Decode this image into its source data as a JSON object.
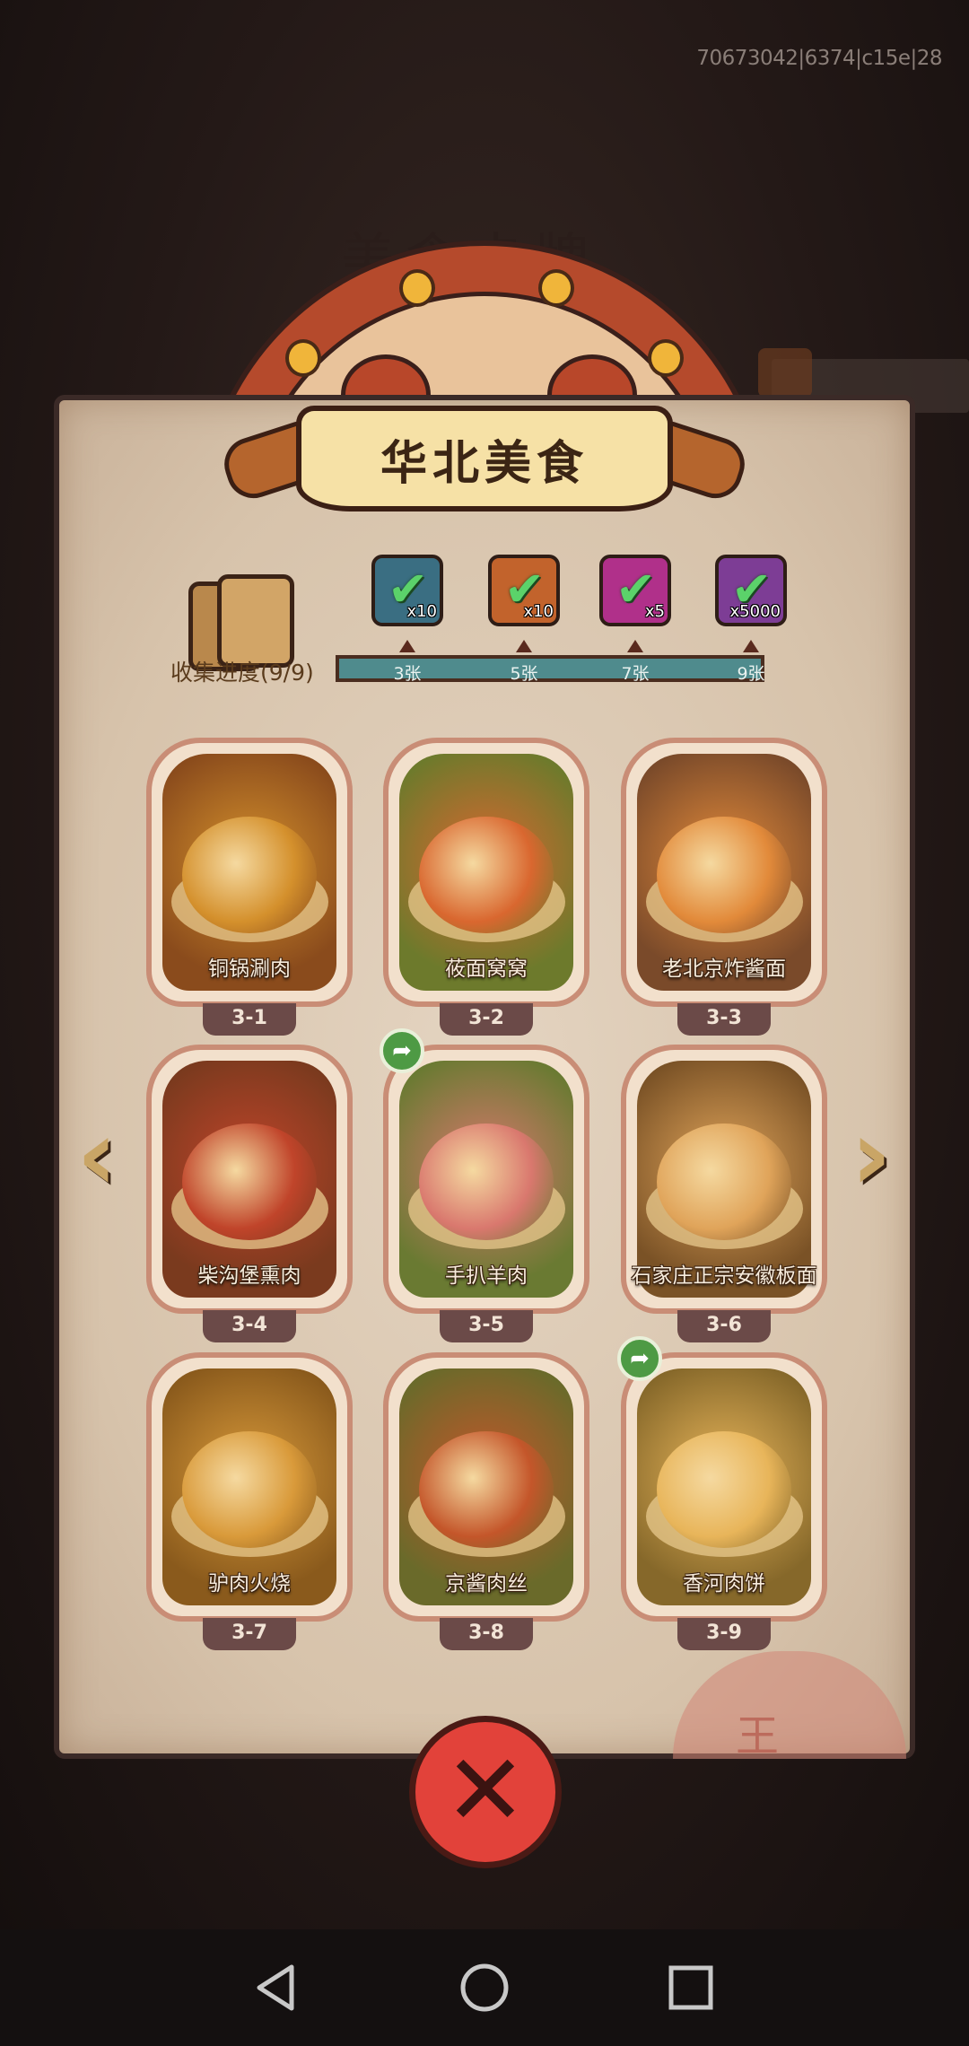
{
  "status": {
    "build_id": "70673042|6374|c15e|28"
  },
  "background": {
    "title_ghost": "美食卡牌"
  },
  "panel": {
    "title": "华北美食",
    "progress_label": "收集进度(9/9)",
    "progress_fraction": 1.0,
    "rewards": [
      {
        "icon": "chest-reward-icon",
        "qty": "x10",
        "claimed": true,
        "color": "#3a6e82"
      },
      {
        "icon": "key-reward-icon",
        "qty": "x10",
        "claimed": true,
        "color": "#c2632c"
      },
      {
        "icon": "orb-reward-icon",
        "qty": "x5",
        "claimed": true,
        "color": "#b0308a"
      },
      {
        "icon": "crystal-reward-icon",
        "qty": "x5000",
        "claimed": true,
        "color": "#7d3d95"
      }
    ],
    "milestones": [
      "3张",
      "5张",
      "7张",
      "9张"
    ],
    "foods": [
      {
        "name": "铜锅涮肉",
        "level": "3-1",
        "share": false,
        "bg": "#8a4b1c",
        "dish": "#d4902c"
      },
      {
        "name": "莜面窝窝",
        "level": "3-2",
        "share": false,
        "bg": "#6d7a2c",
        "dish": "#d9672f"
      },
      {
        "name": "老北京炸酱面",
        "level": "3-3",
        "share": false,
        "bg": "#7a4a2a",
        "dish": "#e28a3a"
      },
      {
        "name": "柴沟堡熏肉",
        "level": "3-4",
        "share": false,
        "bg": "#7a3a1e",
        "dish": "#c0442a"
      },
      {
        "name": "手扒羊肉",
        "level": "3-5",
        "share": true,
        "bg": "#6a7a32",
        "dish": "#d9786e"
      },
      {
        "name": "石家庄正宗安徽板面",
        "level": "3-6",
        "share": false,
        "bg": "#7a5226",
        "dish": "#e0a45a"
      },
      {
        "name": "驴肉火烧",
        "level": "3-7",
        "share": false,
        "bg": "#8a5a1c",
        "dish": "#d99a3a"
      },
      {
        "name": "京酱肉丝",
        "level": "3-8",
        "share": false,
        "bg": "#6a6a2a",
        "dish": "#c4562a"
      },
      {
        "name": "香河肉饼",
        "level": "3-9",
        "share": true,
        "bg": "#86682a",
        "dish": "#e8b55a"
      }
    ]
  },
  "nav": {
    "prev_glyph": "‹",
    "next_glyph": "›"
  },
  "close_glyph": "✕",
  "system": {
    "back": "back-icon",
    "home": "home-icon",
    "recents": "recents-icon"
  }
}
